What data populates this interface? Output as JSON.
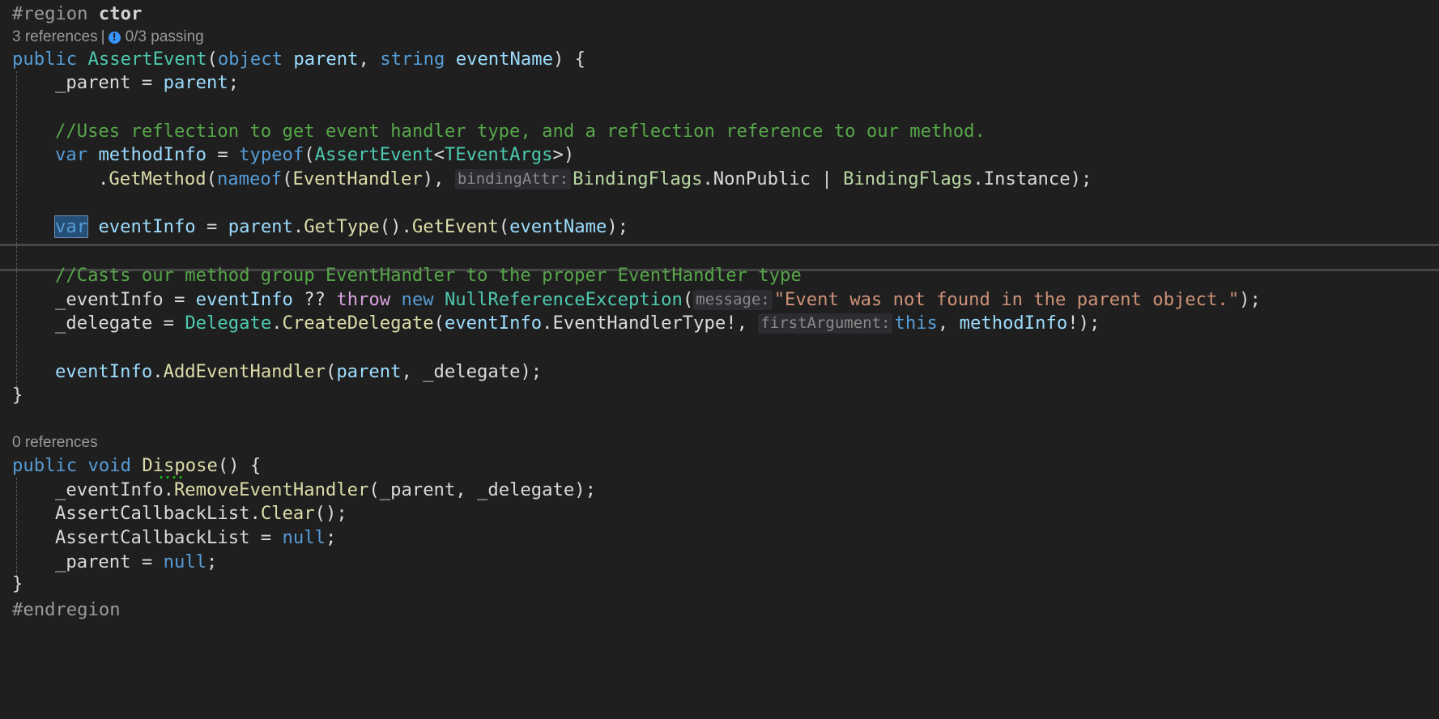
{
  "editor": {
    "region_start": {
      "directive": "#region",
      "name": "ctor"
    },
    "codelens_ctor": {
      "references": "3 references",
      "separator": "|",
      "tests": "0/3 passing",
      "icon": "info-icon"
    },
    "ctor_signature": {
      "kw_public": "public",
      "name": "AssertEvent",
      "open": "(",
      "type1": "object",
      "param1": "parent",
      "comma": ",",
      "type2": "string",
      "param2": "eventName",
      "close": ") {"
    },
    "line_parent_assign": {
      "lhs": "_parent",
      "op": " = ",
      "rhs": "parent",
      "end": ";"
    },
    "comment1": "//Uses reflection to get event handler type, and a reflection reference to our method.",
    "line_methodinfo": {
      "kw_var": "var",
      "name": "methodInfo",
      "op": " = ",
      "kw_typeof": "typeof",
      "open": "(",
      "type": "AssertEvent",
      "lt": "<",
      "type_arg": "TEventArgs",
      "gt": ">",
      "close": ")"
    },
    "line_getmethod": {
      "dot": ".",
      "fn": "GetMethod",
      "open": "(",
      "kw_nameof": "nameof",
      "open2": "(",
      "arg": "EventHandler",
      "close2": "),",
      "hint": "bindingAttr:",
      "enum1": "BindingFlags",
      "dot1": ".",
      "member1": "NonPublic",
      "pipe": " | ",
      "enum2": "BindingFlags",
      "dot2": ".",
      "member2": "Instance",
      "end": ");"
    },
    "line_eventinfo": {
      "kw_var": "var",
      "name": "eventInfo",
      "op": " = ",
      "obj": "parent",
      "dot1": ".",
      "fn1": "GetType",
      "paren": "()",
      "dot2": ".",
      "fn2": "GetEvent",
      "open": "(",
      "arg": "eventName",
      "end": ");"
    },
    "comment2": "//Casts our method group EventHandler to the proper EventHandler type",
    "line_throw": {
      "lhs": "_eventInfo",
      "op": " = ",
      "var": "eventInfo",
      "coalesce": " ?? ",
      "kw_throw": "throw",
      "kw_new": "new",
      "type": "NullReferenceException",
      "open": "(",
      "hint": "message:",
      "string": "\"Event was not found in the parent object.\"",
      "end": ");"
    },
    "line_delegate": {
      "lhs": "_delegate",
      "op": " = ",
      "type": "Delegate",
      "dot": ".",
      "fn": "CreateDelegate",
      "open": "(",
      "var": "eventInfo",
      "dot2": ".",
      "prop": "EventHandlerType",
      "bang": "!,",
      "hint": "firstArgument:",
      "kw_this": "this",
      "comma": ",",
      "arg2": "methodInfo",
      "end": "!);"
    },
    "line_addhandler": {
      "var": "eventInfo",
      "dot": ".",
      "fn": "AddEventHandler",
      "open": "(",
      "arg1": "parent",
      "comma": ", ",
      "arg2": "_delegate",
      "end": ");"
    },
    "close_brace": "}",
    "codelens_dispose": {
      "references": "0 references"
    },
    "dispose_signature": {
      "kw_public": "public",
      "kw_void": "void",
      "name": "Dispose",
      "rest": "() {"
    },
    "line_remove": {
      "obj": "_eventInfo",
      "dot": ".",
      "fn": "RemoveEventHandler",
      "open": "(",
      "arg1": "_parent",
      "comma": ", ",
      "arg2": "_delegate",
      "end": ");"
    },
    "line_clear": {
      "obj": "AssertCallbackList",
      "dot": ".",
      "fn": "Clear",
      "end": "();"
    },
    "line_list_null": {
      "lhs": "AssertCallbackList",
      "op": " = ",
      "kw_null": "null",
      "end": ";"
    },
    "line_parent_null": {
      "lhs": "_parent",
      "op": " = ",
      "kw_null": "null",
      "end": ";"
    },
    "region_end": "#endregion"
  }
}
